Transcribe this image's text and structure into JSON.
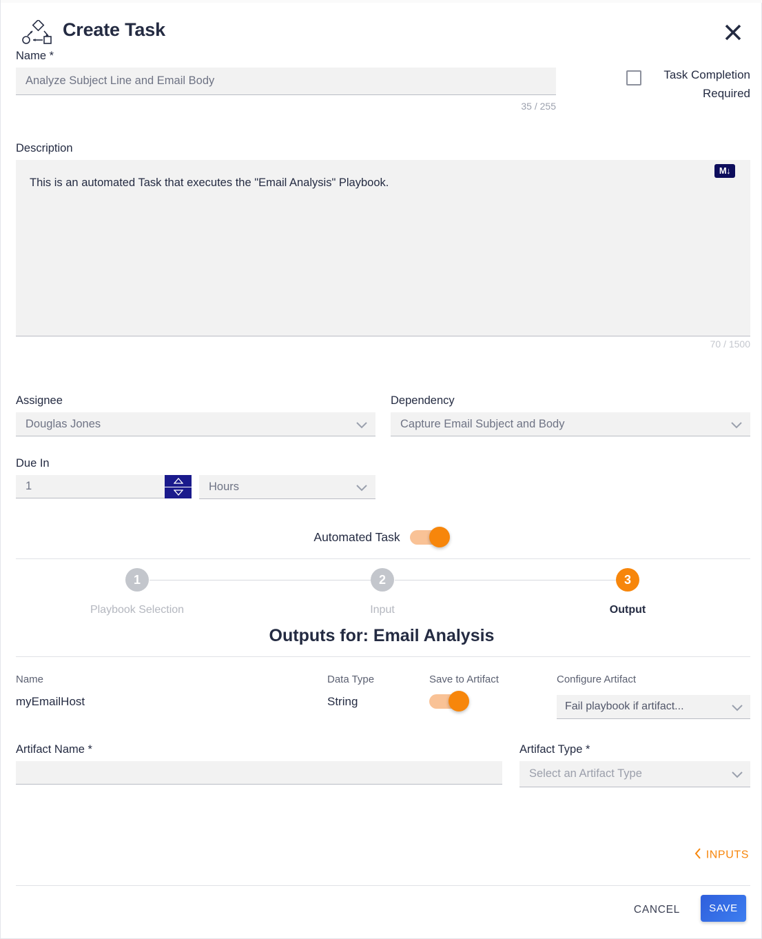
{
  "header": {
    "title": "Create Task",
    "icon": "workflow-icon",
    "close_icon": "close-icon"
  },
  "name_field": {
    "label": "Name *",
    "value": "Analyze Subject Line and Email Body",
    "placeholder": "",
    "counter": "35 / 255"
  },
  "task_completion": {
    "label": "Task Completion Required",
    "checked": false
  },
  "description_field": {
    "label": "Description",
    "value": "This is an automated Task that executes the \"Email Analysis\" Playbook.",
    "counter": "70 / 1500",
    "markdown_icon_label": "M↓"
  },
  "assignee": {
    "label": "Assignee",
    "value": "Douglas Jones"
  },
  "dependency": {
    "label": "Dependency",
    "value": "Capture Email Subject and Body"
  },
  "due_in": {
    "label": "Due In",
    "value": "1",
    "units": "Hours"
  },
  "automated_task": {
    "label": "Automated Task",
    "enabled": true
  },
  "stepper": {
    "steps": [
      {
        "number": "1",
        "label": "Playbook Selection",
        "active": false
      },
      {
        "number": "2",
        "label": "Input",
        "active": false
      },
      {
        "number": "3",
        "label": "Output",
        "active": true
      }
    ]
  },
  "outputs": {
    "title": "Outputs for: Email Analysis",
    "columns": {
      "name": "Name",
      "data_type": "Data Type",
      "save_to_artifact": "Save to Artifact",
      "configure_artifact": "Configure Artifact"
    },
    "rows": [
      {
        "name": "myEmailHost",
        "data_type": "String",
        "save_to_artifact": true,
        "configure_artifact": "Fail playbook if artifact..."
      }
    ]
  },
  "artifact_name": {
    "label": "Artifact Name *",
    "value": "",
    "placeholder": ""
  },
  "artifact_type": {
    "label": "Artifact Type *",
    "value": "",
    "placeholder": "Select an Artifact Type"
  },
  "nav": {
    "inputs_link": "INPUTS",
    "inputs_chevron": "chevron-left-icon"
  },
  "footer": {
    "cancel_label": "CANCEL",
    "save_label": "SAVE"
  },
  "colors": {
    "accent_orange": "#f7860b",
    "save_blue": "#2f5fdc",
    "text_dark": "#242b42",
    "field_bg": "#f2f2f2",
    "spinner_navy": "#1a1a8c",
    "markdown_navy": "#0d0d5c"
  }
}
